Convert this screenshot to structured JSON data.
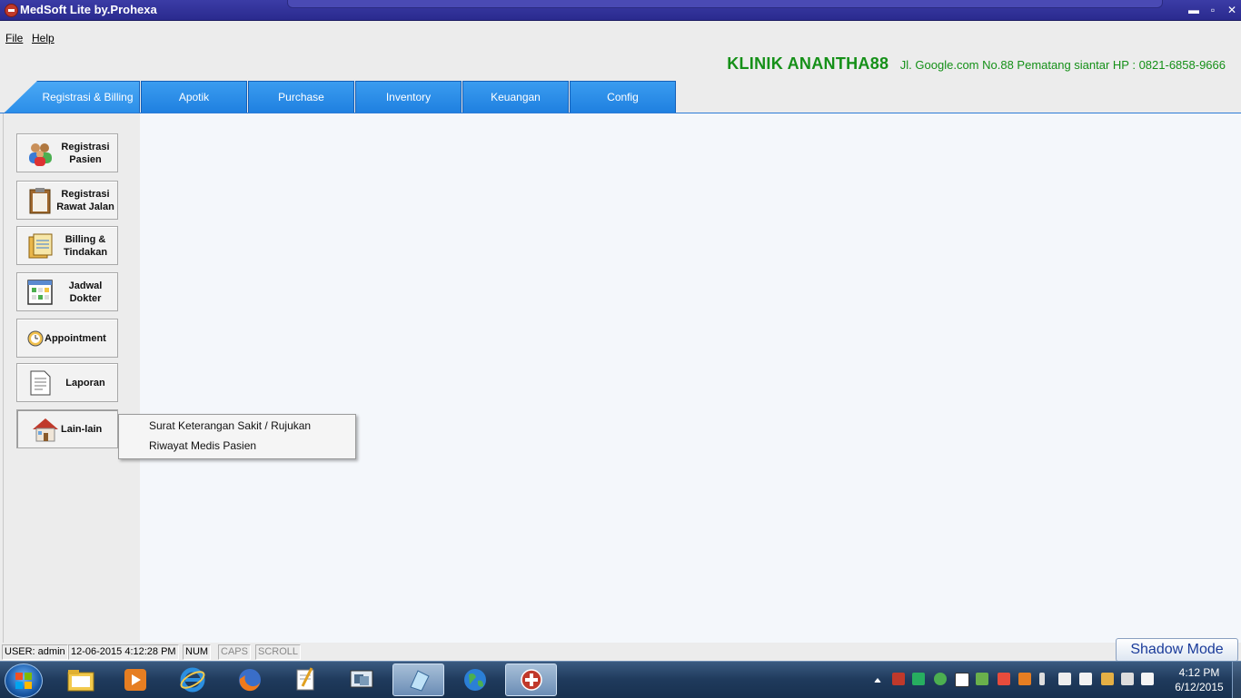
{
  "window": {
    "title": "MedSoft Lite by.Prohexa",
    "buttons": {
      "minimize": "▬",
      "maximize": "▫",
      "close": "✕"
    }
  },
  "menu": {
    "file": "File",
    "help": "Help"
  },
  "clinic": {
    "name": "KLINIK ANANTHA88",
    "address": "Jl. Google.com No.88  Pematang siantar HP : 0821-6858-9666",
    "color": "#159018"
  },
  "tabs": [
    {
      "label": "Registrasi & Billing",
      "active": true
    },
    {
      "label": "Apotik"
    },
    {
      "label": "Purchase"
    },
    {
      "label": "Inventory"
    },
    {
      "label": "Keuangan"
    },
    {
      "label": "Config"
    }
  ],
  "sidebar": {
    "buttons": [
      {
        "label": "Registrasi\nPasien",
        "icon": "users-icon"
      },
      {
        "label": "Registrasi\nRawat Jalan",
        "icon": "clipboard-icon"
      },
      {
        "label": "Billing &\nTindakan",
        "icon": "notebook-icon"
      },
      {
        "label": "Jadwal\nDokter",
        "icon": "calendar-icon"
      },
      {
        "label": "Appointment",
        "icon": "clock-icon"
      },
      {
        "label": "Laporan",
        "icon": "document-icon"
      },
      {
        "label": "Lain-lain",
        "icon": "house-icon"
      }
    ]
  },
  "popup_menu": {
    "items": [
      "Surat Keterangan Sakit / Rujukan",
      "Riwayat Medis Pasien"
    ]
  },
  "status": {
    "user": "USER: admin",
    "datetime": "12-06-2015 4:12:28 PM",
    "num": "NUM",
    "caps": "CAPS",
    "scroll": "SCROLL"
  },
  "shadow_mode": "Shadow Mode",
  "taskbar": {
    "items": [
      "explorer-icon",
      "media-player-icon",
      "internet-explorer-icon",
      "firefox-icon",
      "notepad-icon",
      "virtual-pc-icon",
      "paint-icon",
      "globe-icon",
      "medsoft-icon"
    ],
    "clock_time": "4:12 PM",
    "clock_date": "6/12/2015"
  },
  "colors": {
    "tab_blue": "#1f80e0",
    "title_blue": "#2a2a8e",
    "taskbar": "#1f3a5c"
  }
}
